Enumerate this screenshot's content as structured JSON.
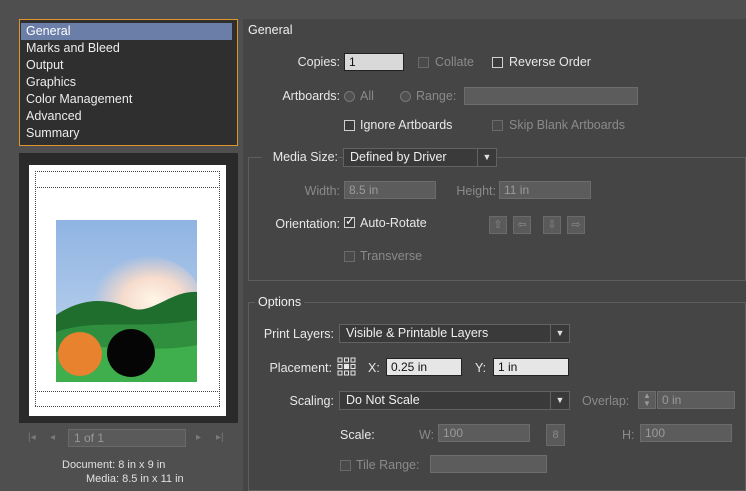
{
  "categories": [
    "General",
    "Marks and Bleed",
    "Output",
    "Graphics",
    "Color Management",
    "Advanced",
    "Summary"
  ],
  "preview": {
    "page_indicator": "1 of 1",
    "document_size": "Document: 8 in x 9 in",
    "media_size": "Media: 8.5 in x 11 in"
  },
  "general": {
    "title": "General",
    "copies_label": "Copies:",
    "copies_value": "1",
    "collate_label": "Collate",
    "reverse_order_label": "Reverse Order",
    "artboards_label": "Artboards:",
    "all_label": "All",
    "range_label": "Range:",
    "ignore_artboards_label": "Ignore Artboards",
    "skip_blank_label": "Skip Blank Artboards"
  },
  "media": {
    "media_size_label": "Media Size:",
    "media_size_value": "Defined by Driver",
    "width_label": "Width:",
    "width_value": "8.5 in",
    "height_label": "Height:",
    "height_value": "11 in",
    "orientation_label": "Orientation:",
    "auto_rotate_label": "Auto-Rotate",
    "auto_rotate_checked": true,
    "transverse_label": "Transverse"
  },
  "options": {
    "title": "Options",
    "print_layers_label": "Print Layers:",
    "print_layers_value": "Visible & Printable Layers",
    "placement_label": "Placement:",
    "x_label": "X:",
    "x_value": "0.25 in",
    "y_label": "Y:",
    "y_value": "1 in",
    "scaling_label": "Scaling:",
    "scaling_value": "Do Not Scale",
    "overlap_label": "Overlap:",
    "overlap_value": "0 in",
    "scale_label": "Scale:",
    "w_label": "W:",
    "w_value": "100",
    "h_label": "H:",
    "h_value": "100",
    "tile_range_label": "Tile Range:"
  }
}
